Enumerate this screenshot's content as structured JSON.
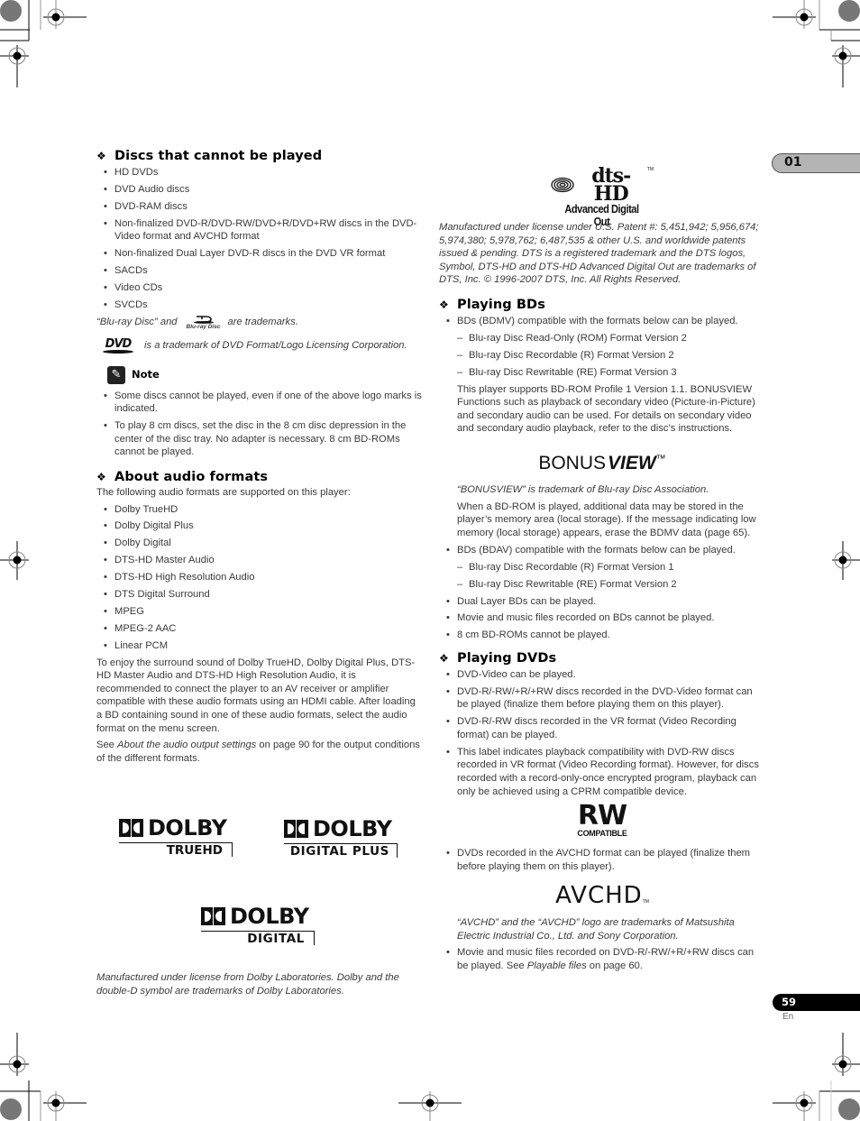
{
  "chapter_tab": "01",
  "page_number": "59",
  "page_lang": "En",
  "left": {
    "discs_cannot": {
      "heading": "Discs that cannot be played",
      "items": [
        "HD DVDs",
        "DVD Audio discs",
        "DVD-RAM discs",
        "Non-finalized DVD-R/DVD-RW/DVD+R/DVD+RW discs in the DVD-Video format and AVCHD format",
        "Non-finalized Dual Layer DVD-R discs in the DVD VR format",
        "SACDs",
        "Video CDs",
        "SVCDs"
      ],
      "bluray_tm_pre": "“Blu-ray Disc” and",
      "bluray_tm_post": "are trademarks.",
      "bluray_logo_text": "Blu-ray Disc",
      "dvd_logo_text": "DVD",
      "dvd_tm": "is a trademark of DVD Format/Logo Licensing Corporation."
    },
    "note": {
      "label": "Note",
      "items": [
        "Some discs cannot be played, even if one of the above logo marks is indicated.",
        "To play 8 cm discs, set the disc in the 8 cm disc depression in the center of the disc tray. No adapter is necessary. 8 cm BD-ROMs cannot be played."
      ]
    },
    "audio": {
      "heading": "About audio formats",
      "intro": "The following audio formats are supported on this player:",
      "items": [
        "Dolby TrueHD",
        "Dolby Digital Plus",
        "Dolby Digital",
        "DTS-HD Master Audio",
        "DTS-HD High Resolution Audio",
        "DTS Digital Surround",
        "MPEG",
        "MPEG-2 AAC",
        "Linear PCM"
      ],
      "para": "To enjoy the surround sound of Dolby TrueHD, Dolby Digital Plus, DTS-HD Master Audio and DTS-HD High Resolution Audio, it is recommended to connect the player to an AV receiver or amplifier compatible with these audio formats using an HDMI cable. After loading a BD containing sound in one of these audio formats, select the audio format on the menu screen.",
      "see_pre": "See ",
      "see_link": "About the audio output settings",
      "see_post": " on page 90 for the output conditions of the different formats."
    },
    "logos": {
      "dolby": "DOLBY",
      "truehd": "TRUEHD",
      "digital_plus": "DIGITAL PLUS",
      "digital": "DIGITAL"
    },
    "dolby_tm": "Manufactured under license from Dolby Laboratories. Dolby and the double-D symbol are trademarks of Dolby Laboratories."
  },
  "right": {
    "dts_logo": {
      "main": "dts-HD",
      "tm": "TM",
      "sub": "Advanced Digital Out"
    },
    "dts_tm": "Manufactured under license under U.S. Patent #: 5,451,942; 5,956,674; 5,974,380; 5,978,762; 6,487,535 & other U.S. and worldwide patents issued & pending. DTS is a registered trademark and the DTS logos, Symbol, DTS-HD and DTS-HD Advanced Digital Out are trademarks of DTS, Inc. © 1996-2007 DTS, Inc. All Rights Reserved.",
    "bds": {
      "heading": "Playing BDs",
      "item1": "BDs (BDMV) compatible with the formats below can be played.",
      "sub1": [
        "Blu-ray Disc Read-Only (ROM) Format Version 2",
        "Blu-ray Disc Recordable (R) Format Version 2",
        "Blu-ray Disc Rewritable (RE) Format Version 3"
      ],
      "profile_para": "This player supports BD-ROM Profile 1 Version 1.1. BONUSVIEW Functions such as playback of secondary video (Picture-in-Picture) and secondary audio can be used. For details on secondary video and secondary audio playback, refer to the disc’s instructions.",
      "bonus_logo_a": "BONUS",
      "bonus_logo_b": "VIEW",
      "bonus_logo_tm": "™",
      "bonus_tm": "“BONUSVIEW” is trademark of Blu-ray Disc Association.",
      "storage_para": "When a BD-ROM is played, additional data may be stored in the player’s memory area (local storage). If the message indicating low memory (local storage) appears, erase the BDMV data (page 65).",
      "item2": "BDs (BDAV) compatible with the formats below can be played.",
      "sub2": [
        "Blu-ray Disc Recordable (R) Format Version 1",
        "Blu-ray Disc Rewritable (RE) Format Version 2"
      ],
      "items_more": [
        "Dual Layer BDs can be played.",
        "Movie and music files recorded on BDs cannot be played.",
        "8 cm BD-ROMs cannot be played."
      ]
    },
    "dvds": {
      "heading": "Playing DVDs",
      "items": [
        "DVD-Video can be played.",
        "DVD-R/-RW/+R/+RW discs recorded in the DVD-Video format can be played (finalize them before playing them on this player).",
        "DVD-R/-RW discs recorded in the VR format (Video Recording format) can be played.",
        "This label indicates playback compatibility with DVD-RW discs recorded in VR format (Video Recording format). However, for discs recorded with a record-only-once encrypted program, playback can only be achieved using a CPRM compatible device."
      ],
      "rw_logo": "RW",
      "rw_sub": "COMPATIBLE",
      "avchd_item": "DVDs recorded in the AVCHD format can be played (finalize them before playing them on this player).",
      "avchd_logo": "AVCHD",
      "avchd_tm_mark": "TM",
      "avchd_tm": "“AVCHD” and the “AVCHD” logo are trademarks of Matsushita Electric Industrial Co., Ltd. and Sony Corporation.",
      "files_pre": "Movie and music files recorded on DVD-R/-RW/+R/+RW discs can be played. See ",
      "files_link": "Playable files",
      "files_post": " on page 60."
    }
  }
}
